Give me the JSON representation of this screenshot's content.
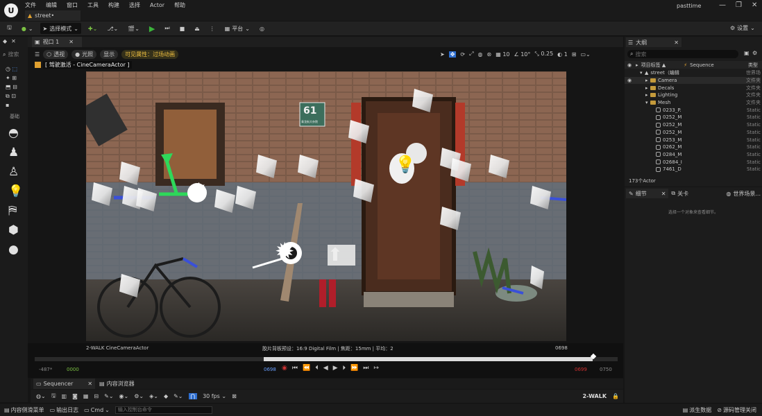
{
  "app": {
    "logo": "U",
    "menu": [
      "文件",
      "编辑",
      "窗口",
      "工具",
      "构建",
      "选择",
      "Actor",
      "帮助"
    ],
    "doc_tab": "street•",
    "user": "pasttime",
    "win": [
      "—",
      "❐",
      "✕"
    ]
  },
  "toolbar": {
    "select_mode": "选择模式",
    "platform": "平台",
    "settings": "设置"
  },
  "left": {
    "search": "搜索",
    "basic": "基础"
  },
  "viewport": {
    "tab": "视口 1",
    "perspective": "透视",
    "lit": "光照",
    "show": "显示",
    "visibility": "可见属性：过场动画",
    "grid": "10",
    "rot": "10°",
    "scale": "0.25",
    "cams": "1",
    "pilot": "[ 驾驶激活 - CineCameraActor ]",
    "cam_label": "2-WALK CineCameraActor",
    "film": "胶片背板预设：16:9 Digital Film | 焦距：15mm | 平均：2",
    "frame": "0698",
    "plate": "61",
    "plate_sub": "青龙街大杂院"
  },
  "sequencer": {
    "left": "-487*",
    "start": "0000",
    "cur": "0698",
    "endred": "0699",
    "end": "0750"
  },
  "bottom": {
    "tab_seq": "Sequencer",
    "tab_content": "内容浏览器",
    "fps": "30 fps",
    "shot": "2-WALK"
  },
  "status": {
    "drawer": "内容侧滑菜单",
    "log": "输出日志",
    "cmd": "Cmd",
    "cmd_ph": "输入控制台命令",
    "derived": "派生数据",
    "source": "源码管理关闭"
  },
  "outliner": {
    "title": "大纲",
    "search": "搜索",
    "col_label": "项目标签 ▲",
    "col_seq": "Sequence",
    "col_type": "类型",
    "count": "173个Actor",
    "rows": [
      {
        "name": "street（编辑",
        "type": "世界场",
        "kind": "world",
        "indent": 0
      },
      {
        "name": "Camera",
        "type": "文件夹",
        "kind": "folder",
        "indent": 1
      },
      {
        "name": "Decals",
        "type": "文件夹",
        "kind": "folder",
        "indent": 1
      },
      {
        "name": "Lighting",
        "type": "文件夹",
        "kind": "folder",
        "indent": 1
      },
      {
        "name": "Mesh",
        "type": "文件夹",
        "kind": "folder",
        "indent": 1
      },
      {
        "name": "0233_P.",
        "type": "Static",
        "kind": "mesh",
        "indent": 2
      },
      {
        "name": "0252_M",
        "type": "Static",
        "kind": "mesh",
        "indent": 2
      },
      {
        "name": "0252_M",
        "type": "Static",
        "kind": "mesh",
        "indent": 2
      },
      {
        "name": "0252_M",
        "type": "Static",
        "kind": "mesh",
        "indent": 2
      },
      {
        "name": "0253_M",
        "type": "Static",
        "kind": "mesh",
        "indent": 2
      },
      {
        "name": "0262_M",
        "type": "Static",
        "kind": "mesh",
        "indent": 2
      },
      {
        "name": "0284_M",
        "type": "Static",
        "kind": "mesh",
        "indent": 2
      },
      {
        "name": "02684_I",
        "type": "Static",
        "kind": "mesh",
        "indent": 2
      },
      {
        "name": "7461_D",
        "type": "Static",
        "kind": "mesh",
        "indent": 2
      }
    ]
  },
  "details": {
    "tab1": "细节",
    "tab2": "关卡",
    "tab3": "世界场景...",
    "empty": "选择一个对象来查看细节。"
  }
}
